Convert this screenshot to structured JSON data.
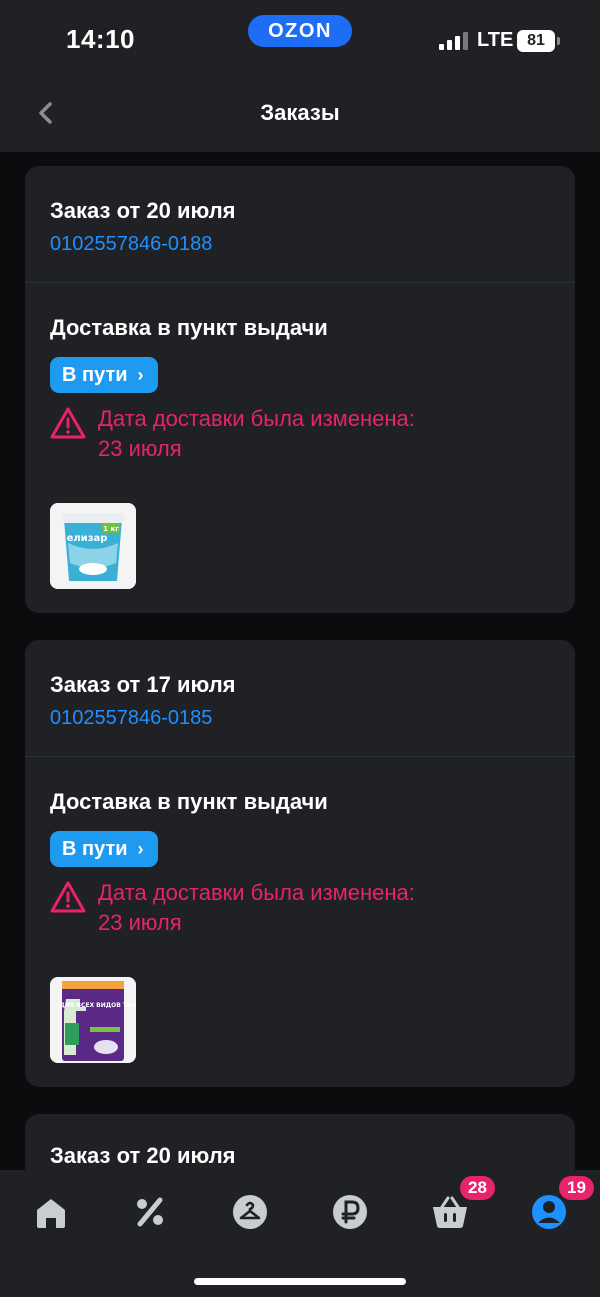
{
  "status_bar": {
    "time": "14:10",
    "brand": "OZON",
    "network": "LTE",
    "battery": "81"
  },
  "header": {
    "title": "Заказы"
  },
  "orders": [
    {
      "title": "Заказ от 20 июля",
      "number": "0102557846-0188",
      "delivery": "Доставка в пункт выдачи",
      "status": "В пути",
      "warning_line1": "Дата доставки была изменена:",
      "warning_line2": "23 июля",
      "thumb_label": "елизар",
      "thumb_weight": "1 кг"
    },
    {
      "title": "Заказ от 17 июля",
      "number": "0102557846-0185",
      "delivery": "Доставка в пункт выдачи",
      "status": "В пути",
      "warning_line1": "Дата доставки была изменена:",
      "warning_line2": "23 июля",
      "thumb_label": "ДЛЯ ВСЕХ ВИДОВ ТКАНЕЙ"
    },
    {
      "title": "Заказ от 20 июля"
    }
  ],
  "tabbar": {
    "items": [
      "home",
      "promo",
      "catalog",
      "finance",
      "cart",
      "profile"
    ],
    "cart_badge": "28",
    "profile_badge": "19",
    "active": "profile",
    "active_color": "#1e90ff",
    "badge_color": "#e8226c"
  }
}
